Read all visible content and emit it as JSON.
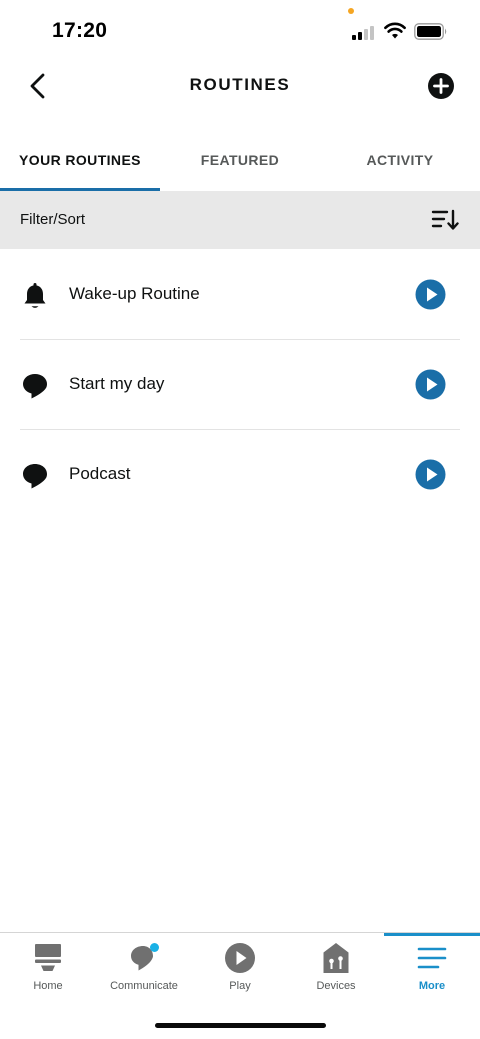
{
  "status_bar": {
    "time": "17:20"
  },
  "header": {
    "title": "ROUTINES",
    "back_icon": "chevron-left-icon",
    "add_icon": "plus-circle-icon"
  },
  "tabs": [
    {
      "label": "YOUR ROUTINES",
      "active": true
    },
    {
      "label": "FEATURED",
      "active": false
    },
    {
      "label": "ACTIVITY",
      "active": false
    }
  ],
  "filter_bar": {
    "label": "Filter/Sort",
    "icon": "sort-icon"
  },
  "routines": [
    {
      "label": "Wake-up Routine",
      "icon": "alarm-bell-icon"
    },
    {
      "label": "Start my day",
      "icon": "speech-bubble-icon"
    },
    {
      "label": "Podcast",
      "icon": "speech-bubble-icon"
    }
  ],
  "bottom_nav": [
    {
      "label": "Home",
      "icon": "home-icon",
      "active": false
    },
    {
      "label": "Communicate",
      "icon": "communicate-icon",
      "active": false
    },
    {
      "label": "Play",
      "icon": "play-icon",
      "active": false
    },
    {
      "label": "Devices",
      "icon": "devices-icon",
      "active": false
    },
    {
      "label": "More",
      "icon": "menu-icon",
      "active": true
    }
  ],
  "colors": {
    "accent": "#1a6ea8",
    "nav_active": "#1a8fc9",
    "filter_bg": "#e8e8e8",
    "text": "#0f1111"
  }
}
